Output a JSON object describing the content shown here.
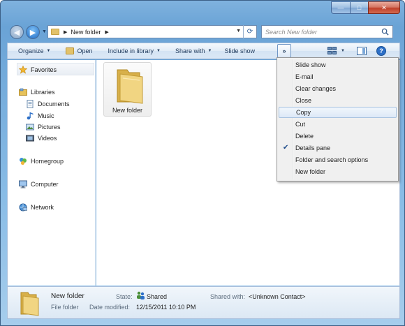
{
  "window": {
    "caption": {
      "minimize": "—",
      "maximize": "□",
      "close": "✕"
    }
  },
  "nav": {
    "back_glyph": "◀",
    "forward_glyph": "▶",
    "history_glyph": "▼"
  },
  "address": {
    "path": "New folder",
    "separator": "▶",
    "dropdown_glyph": "▼",
    "refresh_glyph": "⟳"
  },
  "search": {
    "placeholder": "Search New folder"
  },
  "command_bar": {
    "organize": "Organize",
    "open": "Open",
    "include_in_library": "Include in library",
    "share_with": "Share with",
    "slide_show": "Slide show",
    "more": "»",
    "dropdown_glyph": "▼",
    "help": "?"
  },
  "nav_pane": {
    "favorites": "Favorites",
    "libraries": "Libraries",
    "documents": "Documents",
    "music": "Music",
    "pictures": "Pictures",
    "videos": "Videos",
    "homegroup": "Homegroup",
    "computer": "Computer",
    "network": "Network"
  },
  "files": [
    {
      "name": "New folder"
    }
  ],
  "details": {
    "name": "New folder",
    "type": "File folder",
    "state_label": "State:",
    "state_value": "Shared",
    "modified_label": "Date modified:",
    "modified_value": "12/15/2011 10:10 PM",
    "shared_with_label": "Shared with:",
    "shared_with_value": "<Unknown Contact>"
  },
  "menu": {
    "items": [
      {
        "label": "Slide show"
      },
      {
        "label": "E-mail"
      },
      {
        "label": "Clear changes"
      },
      {
        "label": "Close"
      },
      {
        "label": "Copy"
      },
      {
        "label": "Cut"
      },
      {
        "label": "Delete"
      },
      {
        "label": "Details pane",
        "check": "✔"
      },
      {
        "label": "Folder and search options"
      },
      {
        "label": "New folder"
      }
    ],
    "highlighted_index": 4
  },
  "colors": {
    "frame": "#7fb2de",
    "accent": "#1f6cc6",
    "folder": "#e2c26a"
  }
}
